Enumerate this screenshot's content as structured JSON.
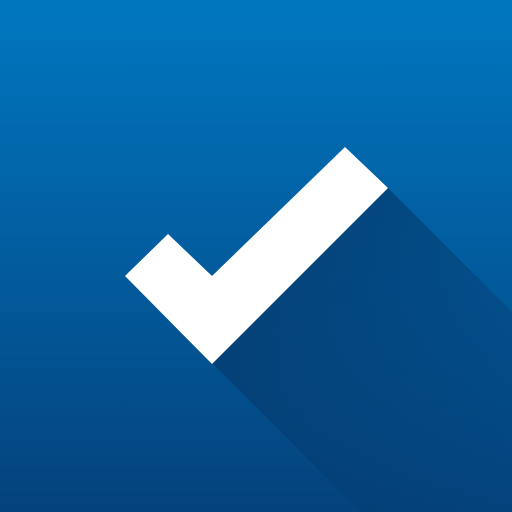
{
  "icon": {
    "name": "checkmark-icon",
    "colors": {
      "background_top": "#0077c0",
      "background_bottom": "#04427c",
      "checkmark": "#ffffff",
      "long_shadow": "#052f5e"
    }
  }
}
